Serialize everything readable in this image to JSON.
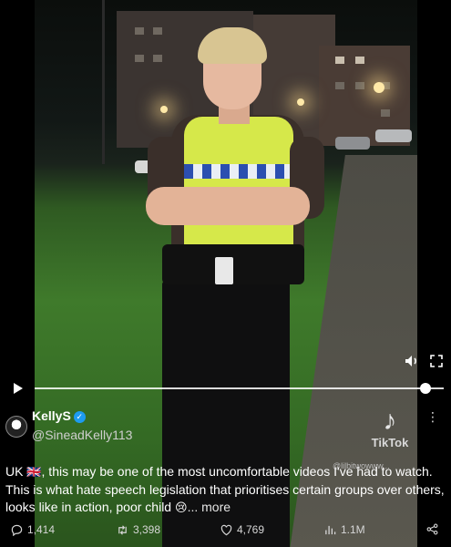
{
  "video": {
    "watermark_brand": "TikTok",
    "watermark_handle": "@lilbitwowww..."
  },
  "player": {
    "play_icon": "play-icon",
    "volume_icon": "volume-icon",
    "fullscreen_icon": "fullscreen-icon",
    "progress": 0.96
  },
  "author": {
    "name": "KellyS",
    "handle": "@SineadKelly113",
    "verified": true
  },
  "tweet": {
    "text_part1": "UK ",
    "flag": "🇬🇧",
    "text_part2": ", this may be one of the most uncomfortable videos I've had to watch. This is what hate speech legislation that prioritises certain groups over others, looks like in action, poor child ",
    "emoji": "😢",
    "more_label": "... more"
  },
  "stats": {
    "replies": "1,414",
    "reposts": "3,398",
    "likes": "4,769",
    "views": "1.1M"
  },
  "colors": {
    "verified_badge": "#1d9bf0",
    "background": "#000000"
  }
}
